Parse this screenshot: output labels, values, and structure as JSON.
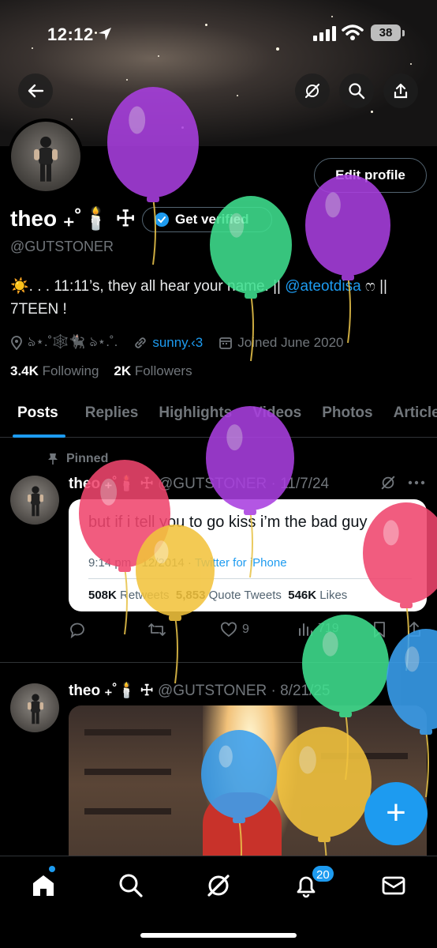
{
  "status_bar": {
    "time": "12:12",
    "battery": "38"
  },
  "header": {
    "edit_profile_label": "Edit profile"
  },
  "profile": {
    "name": "theo ₊˚🕯️ ☩",
    "verify_label": "Get verified",
    "handle": "@GUTSTONER",
    "bio_prefix": "☀️. . . 11:11’s, they all hear your name. || ",
    "bio_mention": "@ateotdisa",
    "bio_suffix": " ෆ || 7TEEN !",
    "location": "ঌ⋆.˚🕸️🐈‍⬛ ঌ⋆.˚.",
    "website": "sunny.‹3",
    "joined": "Joined June 2020",
    "following_count": "3.4K",
    "following_label": "Following",
    "followers_count": "2K",
    "followers_label": "Followers"
  },
  "tabs": [
    "Posts",
    "Replies",
    "Highlights",
    "Videos",
    "Photos",
    "Articles"
  ],
  "pinned_label": "Pinned",
  "posts": [
    {
      "name": "theo ₊˚🕯️ ☩",
      "handle_date": "@GUTSTONER · 11/7/24",
      "quote_text": "but if i tell you to go kiss i’m the bad guy",
      "quote_date": "9:14 pm · 12/2014 · ",
      "quote_source": "Twitter for iPhone",
      "quote_retweets": "508K",
      "quote_retweets_label": "Retweets",
      "quote_quotes": "5,853",
      "quote_quotes_label": "Quote Tweets",
      "quote_likes": "546K",
      "quote_likes_label": "Likes",
      "likes": "9",
      "views": "719"
    },
    {
      "name": "theo ₊˚🕯️ ☩",
      "handle_date": "@GUTSTONER · 8/21/25"
    }
  ],
  "notifications_badge": "20",
  "fab_label": "+",
  "colors": {
    "accent": "#1d9bf0",
    "background": "#000000",
    "muted": "#71767b"
  },
  "balloons": [
    {
      "color": "#a93fe0"
    },
    {
      "color": "#3fe08f"
    },
    {
      "color": "#a93fe0"
    },
    {
      "color": "#a93fe0"
    },
    {
      "color": "#f0466e"
    },
    {
      "color": "#f2c33d"
    },
    {
      "color": "#f0466e"
    },
    {
      "color": "#3fe08f"
    },
    {
      "color": "#3aa0f0"
    },
    {
      "color": "#3aa0f0"
    },
    {
      "color": "#f2c33d"
    }
  ]
}
